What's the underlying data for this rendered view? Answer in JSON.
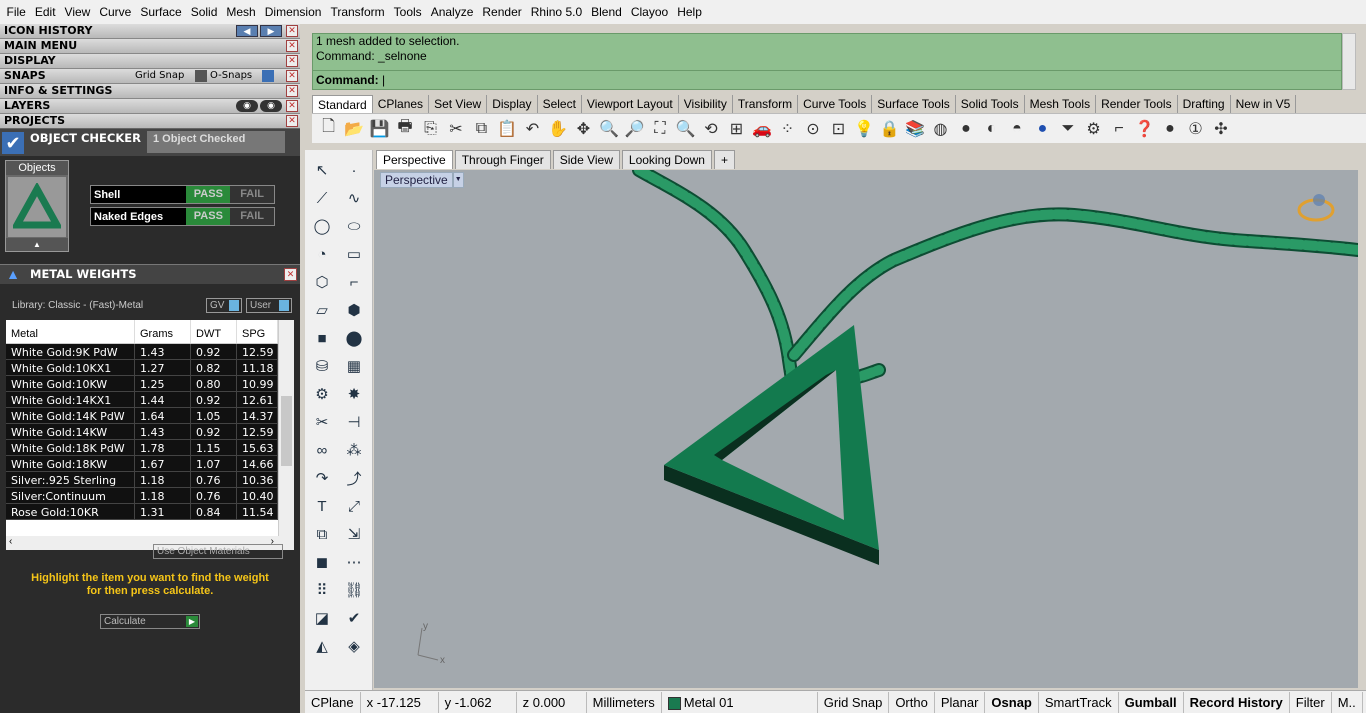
{
  "menu": [
    "File",
    "Edit",
    "View",
    "Curve",
    "Surface",
    "Solid",
    "Mesh",
    "Dimension",
    "Transform",
    "Tools",
    "Analyze",
    "Render",
    "Rhino 5.0",
    "Blend",
    "Clayoo",
    "Help"
  ],
  "panels": {
    "icon_history": "ICON HISTORY",
    "main_menu": "MAIN MENU",
    "display": "DISPLAY",
    "snaps": "SNAPS",
    "grid_snap": "Grid Snap",
    "o_snaps": "O-Snaps",
    "info_settings": "INFO & SETTINGS",
    "layers": "LAYERS",
    "projects": "PROJECTS"
  },
  "object_checker": {
    "title": "OBJECT CHECKER",
    "status": "1  Object Checked",
    "objects_label": "Objects",
    "rows": [
      {
        "name": "Shell",
        "pass": "PASS",
        "fail": "FAIL"
      },
      {
        "name": "Naked Edges",
        "pass": "PASS",
        "fail": "FAIL"
      }
    ]
  },
  "metal_weights": {
    "title": "METAL WEIGHTS",
    "library": "Library: Classic - (Fast)-Metal",
    "gv": "GV",
    "user": "User",
    "headers": [
      "Metal",
      "Grams",
      "DWT",
      "SPG"
    ],
    "rows": [
      [
        "White Gold:9K PdW",
        "1.43",
        "0.92",
        "12.59"
      ],
      [
        "White Gold:10KX1",
        "1.27",
        "0.82",
        "11.18"
      ],
      [
        "White Gold:10KW",
        "1.25",
        "0.80",
        "10.99"
      ],
      [
        "White Gold:14KX1",
        "1.44",
        "0.92",
        "12.61"
      ],
      [
        "White Gold:14K PdW",
        "1.64",
        "1.05",
        "14.37"
      ],
      [
        "White Gold:14KW",
        "1.43",
        "0.92",
        "12.59"
      ],
      [
        "White Gold:18K PdW",
        "1.78",
        "1.15",
        "15.63"
      ],
      [
        "White Gold:18KW",
        "1.67",
        "1.07",
        "14.66"
      ],
      [
        "Silver:.925 Sterling",
        "1.18",
        "0.76",
        "10.36"
      ],
      [
        "Silver:Continuum",
        "1.18",
        "0.76",
        "10.40"
      ],
      [
        "Rose Gold:10KR",
        "1.31",
        "0.84",
        "11.54"
      ]
    ],
    "use_object_materials": "Use Object Materials",
    "highlight_line1": "Highlight the item you want to find the weight",
    "highlight_line2": "for then press calculate.",
    "calculate": "Calculate"
  },
  "command": {
    "line1": "1 mesh added to selection.",
    "line2": "Command: _selnone",
    "prompt": "Command:"
  },
  "toolbar_tabs": [
    "Standard",
    "CPlanes",
    "Set View",
    "Display",
    "Select",
    "Viewport Layout",
    "Visibility",
    "Transform",
    "Curve Tools",
    "Surface Tools",
    "Solid Tools",
    "Mesh Tools",
    "Render Tools",
    "Drafting",
    "New in V5"
  ],
  "viewport_tabs": [
    "Perspective",
    "Through Finger",
    "Side View",
    "Looking Down",
    "+"
  ],
  "viewport_label": "Perspective",
  "axis": {
    "x": "x",
    "y": "y"
  },
  "status": {
    "cplane": "CPlane",
    "x": "x -17.125",
    "y": "y -1.062",
    "z": "z 0.000",
    "units": "Millimeters",
    "layer": "Metal 01",
    "grid_snap": "Grid Snap",
    "ortho": "Ortho",
    "planar": "Planar",
    "osnap": "Osnap",
    "smarttrack": "SmartTrack",
    "gumball": "Gumball",
    "record_history": "Record History",
    "filter": "Filter",
    "more": "M.."
  },
  "colors": {
    "accent_green": "#1a7a50",
    "pass_green": "#2a8a3a",
    "command_bg": "#8fbf8f",
    "viewport_bg": "#a3a9ae",
    "warning_yellow": "#f5c518"
  }
}
